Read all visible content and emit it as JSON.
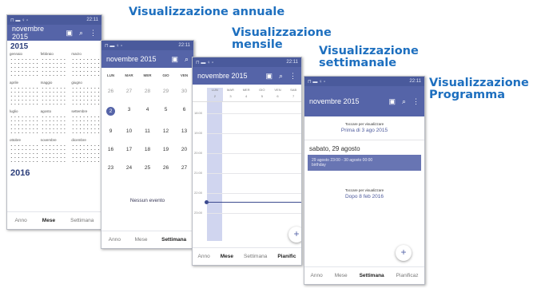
{
  "captions": {
    "annual": "Visualizzazione annuale",
    "monthly": "Visualizzazione mensile",
    "weekly": "Visualizzazione settimanale",
    "agenda": "Visualizzazione Programma"
  },
  "status": {
    "time": "22:11",
    "left_icons": "⊓ ▬ ♀ ▫",
    "right_icons": "⊙ ▾ ◢ ▮"
  },
  "icons": {
    "calendar": "calendar-today-icon",
    "search": "search-icon",
    "menu": "more-vert-icon",
    "fab": "add-icon"
  },
  "colors": {
    "appbar": "#5564a8",
    "statusbar": "#4a5a9c",
    "caption": "#1d6fbf",
    "event": "#6875b3"
  },
  "annual": {
    "title": "novembre 2015",
    "year1": "2015",
    "year2": "2016",
    "months": [
      "gennaio",
      "febbraio",
      "marzo",
      "aprile",
      "maggio",
      "giugno",
      "luglio",
      "agosto",
      "settembre",
      "ottobre",
      "novembre",
      "dicembre"
    ],
    "nav": [
      "Anno",
      "Mese",
      "Settimana"
    ],
    "active_nav": "Anno"
  },
  "monthly": {
    "title": "novembre 2015",
    "dows": [
      "LUN",
      "MAR",
      "MER",
      "GIO",
      "VEN"
    ],
    "weeks": [
      [
        "26",
        "27",
        "28",
        "29",
        "30"
      ],
      [
        "2",
        "3",
        "4",
        "5",
        "6"
      ],
      [
        "9",
        "10",
        "11",
        "12",
        "13"
      ],
      [
        "16",
        "17",
        "18",
        "19",
        "20"
      ],
      [
        "23",
        "24",
        "25",
        "26",
        "27"
      ]
    ],
    "selected": "2",
    "no_event": "Nessun evento",
    "nav": [
      "Anno",
      "Mese",
      "Settimana"
    ],
    "active_nav": "Settimana"
  },
  "weekly": {
    "title": "novembre 2015",
    "dows": [
      "LUN",
      "MAR",
      "MER",
      "GIO",
      "VEN",
      "SAB"
    ],
    "nums": [
      "2",
      "3",
      "4",
      "5",
      "6",
      "7"
    ],
    "hours": [
      "18:00",
      "19:00",
      "20:00",
      "21:00",
      "22:00",
      "23:00"
    ],
    "nav": [
      "Anno",
      "Mese",
      "Settimana",
      "Pianific"
    ],
    "active_nav": "Mese"
  },
  "agenda": {
    "title": "novembre 2015",
    "tap_label": "Toccare per visualizzare",
    "before_date": "Prima di 3 ago 2015",
    "day_header": "sabato, 29 agosto",
    "event_time": "29 agosto 23:00 - 30 agosto 00:00",
    "event_title": "birthday",
    "after_date": "Dopo 8 feb 2016",
    "nav": [
      "Anno",
      "Mese",
      "Settimana",
      "Pianificaz"
    ],
    "active_nav": "Settimana"
  }
}
